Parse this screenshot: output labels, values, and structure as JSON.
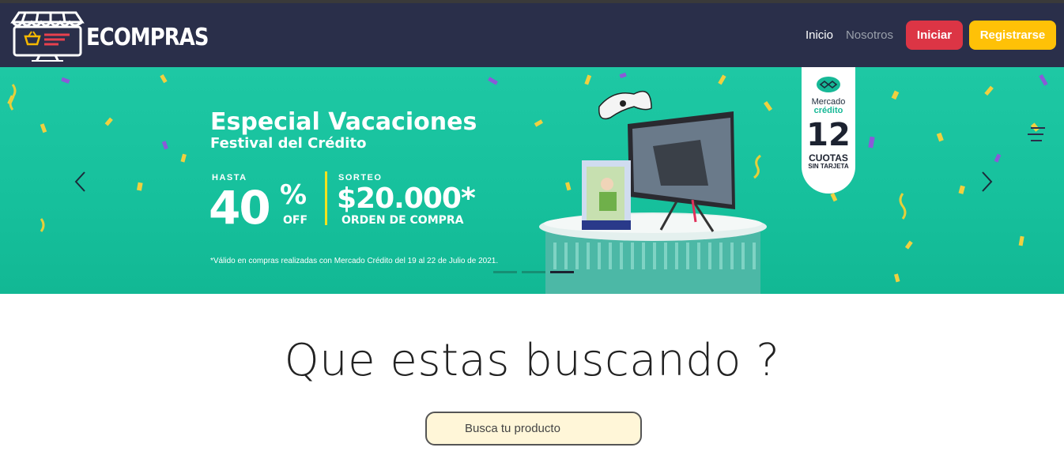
{
  "header": {
    "brand": "ECOMPRAS",
    "nav": [
      {
        "label": "Inicio"
      },
      {
        "label": "Nosotros"
      }
    ],
    "login_label": "Iniciar",
    "register_label": "Registrarse"
  },
  "banner": {
    "title": "Especial Vacaciones",
    "subtitle": "Festival del Crédito",
    "discount_label": "HASTA",
    "discount_value": "40",
    "discount_percent": "%",
    "discount_off": "OFF",
    "raffle_label": "SORTEO",
    "raffle_value": "$20.000*",
    "raffle_sub": "ORDEN DE COMPRA",
    "footnote": "*Válido en compras realizadas con Mercado Crédito del 19 al 22 de Julio de 2021.",
    "badge": {
      "brand_line1": "Mercado",
      "brand_line2": "crédito",
      "number": "12",
      "cuotas": "CUOTAS",
      "sin_tarjeta": "SIN TARJETA"
    },
    "slide_count": 3,
    "active_slide": 3
  },
  "search": {
    "title": "Que estas buscando ?",
    "placeholder": "Busca tu producto"
  },
  "colors": {
    "navbar": "#2a2f4a",
    "hero": "#1ec8a4",
    "danger": "#dc3545",
    "warning": "#ffc107",
    "search_bg": "#fff6d8"
  },
  "icons": {
    "logo": "storefront-icon",
    "prev": "chevron-left-icon",
    "next": "chevron-right-icon",
    "badge": "handshake-icon"
  }
}
